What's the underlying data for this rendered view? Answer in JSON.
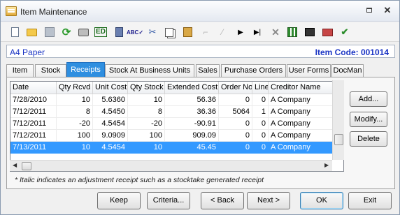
{
  "window": {
    "title": "Item Maintenance"
  },
  "header": {
    "item_name": "A4 Paper",
    "item_code": "Item Code: 001014"
  },
  "tabs": [
    {
      "label": "Item"
    },
    {
      "label": "Stock"
    },
    {
      "label": "Receipts",
      "active": true
    },
    {
      "label": "Stock At Business Units"
    },
    {
      "label": "Sales"
    },
    {
      "label": "Purchase Orders"
    },
    {
      "label": "User Forms"
    },
    {
      "label": "DocMan"
    }
  ],
  "grid": {
    "columns": [
      "Date",
      "Qty Rcvd",
      "Unit Cost",
      "Qty Stock",
      "Extended Cost",
      "Order No",
      "Line",
      "Creditor Name"
    ],
    "rows": [
      [
        "7/28/2010",
        "10",
        "5.6360",
        "10",
        "56.36",
        "0",
        "0",
        "A Company"
      ],
      [
        "7/12/2011",
        "8",
        "4.5450",
        "8",
        "36.36",
        "5064",
        "1",
        "A Company"
      ],
      [
        "7/12/2011",
        "-20",
        "4.5454",
        "-20",
        "-90.91",
        "0",
        "0",
        "A Company"
      ],
      [
        "7/12/2011",
        "100",
        "9.0909",
        "100",
        "909.09",
        "0",
        "0",
        "A Company"
      ],
      [
        "7/13/2011",
        "10",
        "4.5454",
        "10",
        "45.45",
        "0",
        "0",
        "A Company"
      ]
    ],
    "selected_row": 4
  },
  "side_buttons": {
    "add": "Add...",
    "modify": "Modify...",
    "delete": "Delete"
  },
  "note": "* Italic indicates an adjustment receipt such as a stocktake generated receipt",
  "footer": {
    "keep": "Keep",
    "criteria": "Criteria...",
    "back": "< Back",
    "next": "Next >",
    "ok": "OK",
    "exit": "Exit"
  },
  "colors": {
    "accent": "#2f8fe0",
    "selection": "#3399ff",
    "header_text": "#1b35c4"
  }
}
